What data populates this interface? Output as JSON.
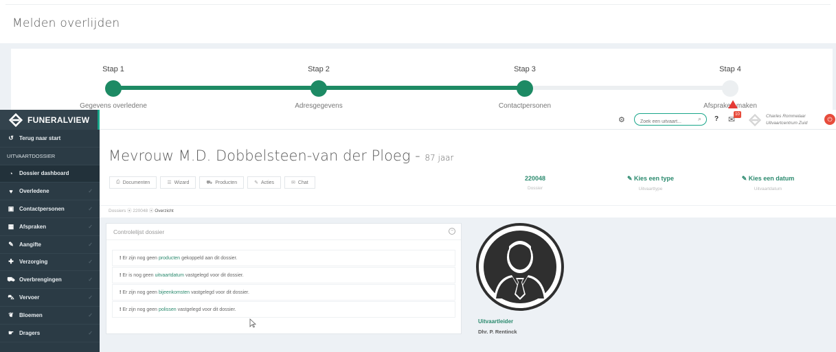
{
  "page": {
    "title": "Melden overlijden"
  },
  "stepper": {
    "steps": [
      {
        "label": "Stap 1",
        "name": "Gegevens overledene",
        "done": true
      },
      {
        "label": "Stap 2",
        "name": "Adresgegevens",
        "done": true
      },
      {
        "label": "Stap 3",
        "name": "Contactpersonen",
        "done": true
      },
      {
        "label": "Stap 4",
        "name": "Afspraken maken",
        "done": false
      }
    ],
    "colors": {
      "done": "#1d8a64",
      "todo": "#eceff1"
    }
  },
  "brand": {
    "name": "FUNERALVIEW",
    "accent": "#17a589"
  },
  "sidebar": {
    "items": [
      {
        "label": "Terug naar start",
        "icon": "back-arrow-icon",
        "type": "link"
      },
      {
        "label": "UITVAARTDOSSIER",
        "icon": "",
        "type": "section"
      },
      {
        "label": "Dossier dashboard",
        "icon": "dashboard-icon",
        "type": "active"
      },
      {
        "label": "Overledene",
        "icon": "heart-icon",
        "type": "item"
      },
      {
        "label": "Contactpersonen",
        "icon": "contact-card-icon",
        "type": "item"
      },
      {
        "label": "Afspraken",
        "icon": "calendar-icon",
        "type": "item"
      },
      {
        "label": "Aangifte",
        "icon": "pencil-icon",
        "type": "item"
      },
      {
        "label": "Verzorging",
        "icon": "medkit-icon",
        "type": "item"
      },
      {
        "label": "Overbrengingen",
        "icon": "car-icon",
        "type": "item"
      },
      {
        "label": "Vervoer",
        "icon": "car-front-icon",
        "type": "item"
      },
      {
        "label": "Bloemen",
        "icon": "leaf-icon",
        "type": "item"
      },
      {
        "label": "Dragers",
        "icon": "hand-icon",
        "type": "item"
      }
    ]
  },
  "topbar": {
    "search_placeholder": "Zoek een uitvaart...",
    "help_label": "?",
    "mail_count": "10",
    "user_name": "Charles Rommelaar",
    "user_org": "Uitvaartcentrum Zuid"
  },
  "dossier": {
    "name": "Mevrouw M.D. Dobbelsteen-van der Ploeg",
    "age": "87 jaar",
    "tabs": [
      {
        "label": "Documenten",
        "icon": "print-icon"
      },
      {
        "label": "Wizard",
        "icon": "list-icon"
      },
      {
        "label": "Producten",
        "icon": "cart-icon"
      },
      {
        "label": "Acties",
        "icon": "wrench-icon"
      },
      {
        "label": "Chat",
        "icon": "chat-icon"
      }
    ],
    "stats": [
      {
        "value": "220048",
        "label": "Dossier"
      },
      {
        "value": "Kies een type",
        "label": "Uitvaarttype"
      },
      {
        "value": "Kies een datum",
        "label": "Uitvaartdatum"
      }
    ]
  },
  "breadcrumb": {
    "dossiers": "Dossiers",
    "number": "220048",
    "current": "Overzicht"
  },
  "checklist": {
    "title": "Controlelijst dossier",
    "items": [
      {
        "pre": "Er zijn nog geen",
        "keyword": "producten",
        "post": "gekoppeld aan dit dossier."
      },
      {
        "pre": "Er is nog geen",
        "keyword": "uitvaartdatum",
        "post": "vastgelegd voor dit dossier."
      },
      {
        "pre": "Er zijn nog geen",
        "keyword": "bijeenkomsten",
        "post": "vastgelegd voor dit dossier."
      },
      {
        "pre": "Er zijn nog geen",
        "keyword": "polissen",
        "post": "vastgelegd voor dit dossier."
      }
    ]
  },
  "director": {
    "role": "Uitvaartleider",
    "name": "Dhr. P. Rentinck"
  }
}
